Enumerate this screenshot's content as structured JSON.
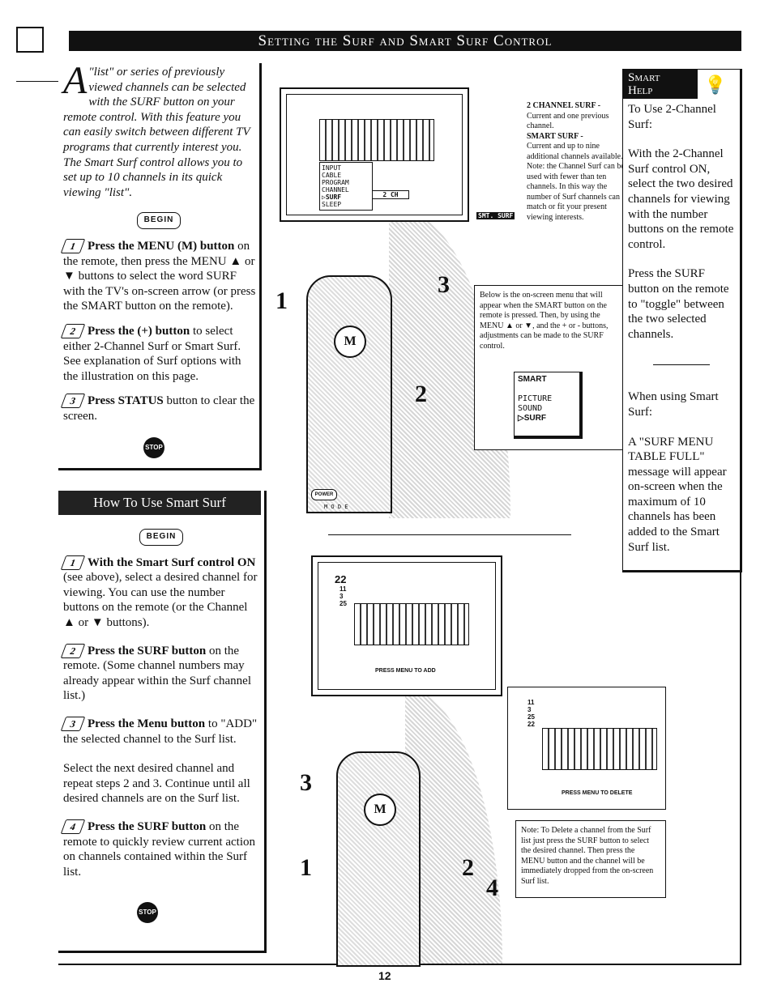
{
  "header": {
    "title": "Setting the Surf and Smart Surf Control"
  },
  "intro": {
    "dropcap": "A",
    "text": "\"list\" or series of previously viewed channels can be selected with the SURF button on your remote control. With this feature you can easily switch between different TV programs that currently interest you. The Smart Surf control allows you to set up to 10 channels in its quick viewing \"list\"."
  },
  "begin_label": "BEGIN",
  "stop_label": "STOP",
  "steps_a": [
    {
      "n": "1",
      "bold": "Press the MENU (M) button",
      "text": " on the remote, then press the MENU ▲ or ▼ buttons to select the word SURF with the TV's on-screen arrow (or press the SMART button on the remote)."
    },
    {
      "n": "2",
      "bold": "Press the (+) button",
      "text": " to select either 2-Channel Surf or Smart Surf. See explanation of Surf options with the illustration on this page."
    },
    {
      "n": "3",
      "bold": "Press STATUS",
      "text": " button to clear the screen."
    }
  ],
  "smart_section": {
    "title": "How To Use Smart Surf",
    "steps": [
      {
        "n": "1",
        "bold": "With the Smart Surf control ON",
        "text": " (see above), select a desired channel for viewing. You can use the number buttons on the remote (or the Channel ▲ or ▼ buttons)."
      },
      {
        "n": "2",
        "bold": "Press the SURF button",
        "text": " on the remote. (Some channel numbers may already appear within the Surf channel list.)"
      },
      {
        "n": "3",
        "bold": "Press the Menu button",
        "text": " to \"ADD\" the selected channel to the Surf list.",
        "extra": "Select the next desired channel and repeat steps 2 and 3. Continue until all desired channels are on the Surf list."
      },
      {
        "n": "4",
        "bold": "Press the SURF button",
        "text": " on the remote to quickly review current action on channels contained within the Surf list."
      }
    ]
  },
  "tv1": {
    "menu": [
      "INPUT",
      "CABLE",
      "PROGRAM",
      "CHANNEL",
      "SURF",
      "SLEEP"
    ],
    "value": "2 CH",
    "badge": "SMT. SURF"
  },
  "surf_info": {
    "two_title": "2 CHANNEL SURF -",
    "two_text": "Current and one previous channel.",
    "smart_title": "SMART SURF -",
    "smart_text": "Current and up to nine additional channels available. Note: the Channel Surf can be used with fewer than ten channels. In this way the number of Surf channels can match or fit your present viewing interests."
  },
  "menu_info": {
    "text": "Below is the on-screen menu that will appear when the SMART button on the remote is pressed. Then, by using the MENU ▲ or ▼, and the + or - buttons, adjustments can be made to the SURF control.",
    "menu_title": "SMART",
    "items": [
      "PICTURE",
      "SOUND",
      "SURF"
    ]
  },
  "smart_help": {
    "title1": "Smart",
    "title2": "Help",
    "p1": "To Use 2-Channel Surf:",
    "p2": "With the 2-Channel Surf control ON, select the two desired channels for viewing with the number buttons on the remote control.",
    "p3": "Press the SURF button on the remote to \"toggle\" between the two selected channels.",
    "p4": "When using Smart Surf:",
    "p5": "A \"SURF MENU TABLE FULL\" message will appear on-screen when the maximum of 10 channels has been added to the Smart Surf list."
  },
  "tv2": {
    "current": "22",
    "list": [
      "11",
      "3",
      "25"
    ],
    "caption": "PRESS MENU TO ADD"
  },
  "tv3": {
    "list": [
      "11",
      "3",
      "25",
      "22"
    ],
    "caption": "PRESS MENU TO DELETE"
  },
  "note": {
    "text": "Note: To Delete a channel from the Surf list just press the SURF button to select the desired channel. Then press the MENU button and the channel will be immediately dropped from the on-screen Surf list."
  },
  "remote_labels": {
    "mode": "M O D E",
    "menu_key": "M",
    "power": "POWER"
  },
  "callouts": [
    "1",
    "2",
    "3",
    "1",
    "2",
    "3",
    "4"
  ],
  "page_number": "12"
}
